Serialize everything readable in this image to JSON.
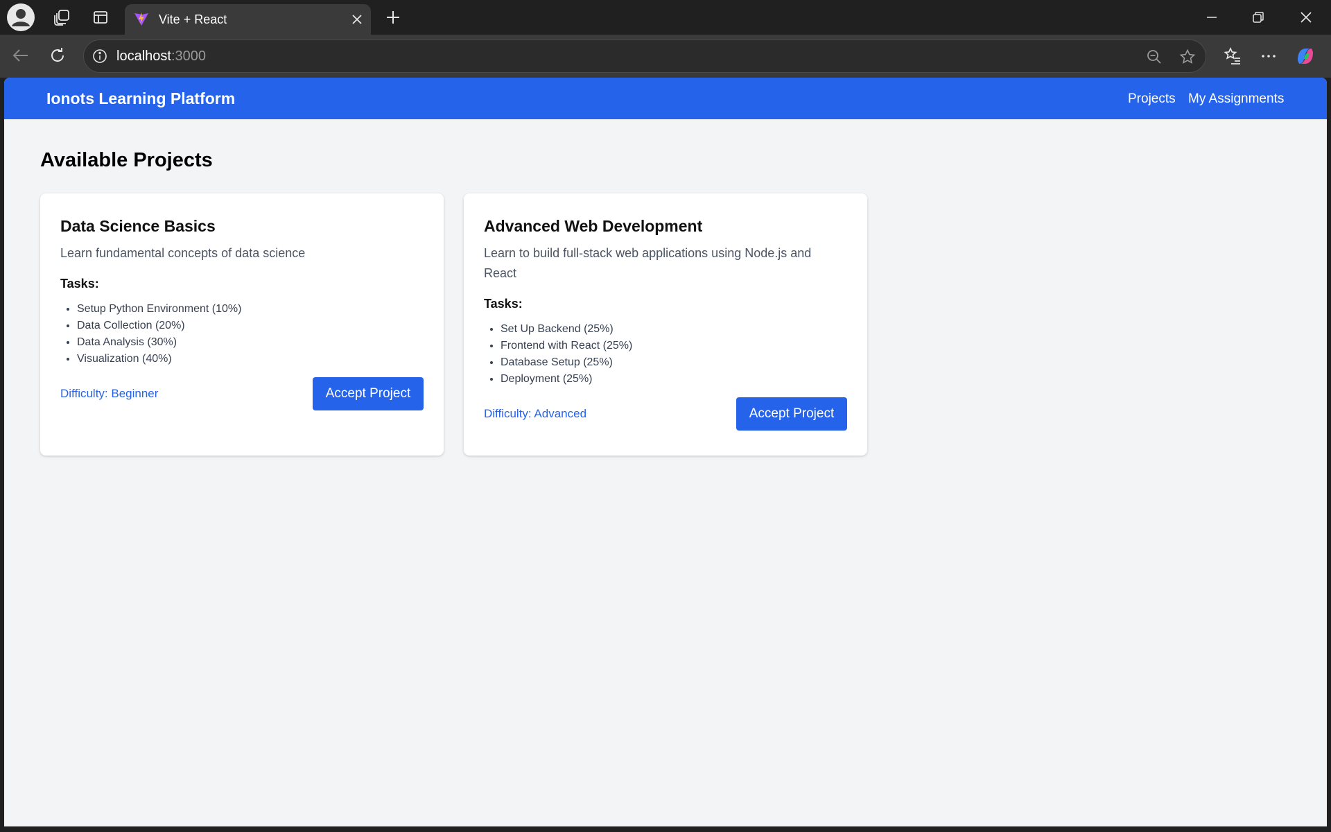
{
  "browser": {
    "tab_title": "Vite + React",
    "url_host": "localhost",
    "url_port": ":3000"
  },
  "app": {
    "brand": "Ionots Learning Platform",
    "nav": {
      "projects": "Projects",
      "assignments": "My Assignments"
    },
    "page_title": "Available Projects",
    "tasks_label": "Tasks:",
    "accept_label": "Accept Project",
    "projects": [
      {
        "title": "Data Science Basics",
        "description": "Learn fundamental concepts of data science",
        "tasks": [
          "Setup Python Environment (10%)",
          "Data Collection (20%)",
          "Data Analysis (30%)",
          "Visualization (40%)"
        ],
        "difficulty": "Difficulty: Beginner"
      },
      {
        "title": "Advanced Web Development",
        "description": "Learn to build full-stack web applications using Node.js and React",
        "tasks": [
          "Set Up Backend (25%)",
          "Frontend with React (25%)",
          "Database Setup (25%)",
          "Deployment (25%)"
        ],
        "difficulty": "Difficulty: Advanced"
      }
    ]
  },
  "colors": {
    "accent": "#2563eb",
    "page_bg": "#f3f4f6",
    "chrome_bg": "#202020"
  }
}
